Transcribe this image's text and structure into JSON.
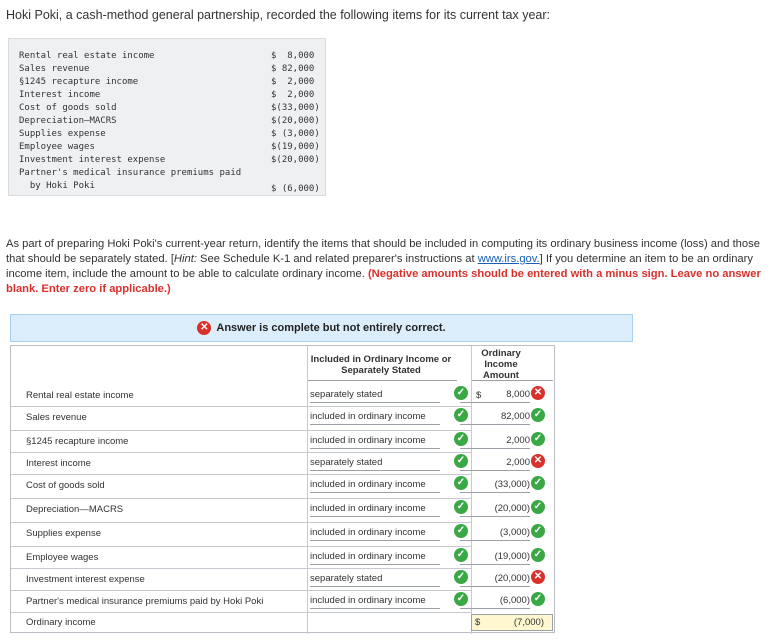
{
  "intro": "Hoki Poki, a cash-method general partnership, recorded the following items for its current tax year:",
  "items": [
    {
      "label": "Rental real estate income",
      "value": "$  8,000"
    },
    {
      "label": "Sales revenue",
      "value": "$ 82,000"
    },
    {
      "label": "§1245 recapture income",
      "value": "$  2,000"
    },
    {
      "label": "Interest income",
      "value": "$  2,000"
    },
    {
      "label": "Cost of goods sold",
      "value": "$(33,000)"
    },
    {
      "label": "Depreciation—MACRS",
      "value": "$(20,000)"
    },
    {
      "label": "Supplies expense",
      "value": "$ (3,000)"
    },
    {
      "label": "Employee wages",
      "value": "$(19,000)"
    },
    {
      "label": "Investment interest expense",
      "value": "$(20,000)"
    },
    {
      "label": "Partner's medical insurance premiums paid",
      "value": ""
    },
    {
      "label": "  by Hoki Poki",
      "value": "$ (6,000)"
    }
  ],
  "instructions": {
    "part1": "As part of preparing Hoki Poki's current-year return, identify the items that should be included in computing its ordinary business income (loss) and those that should be separately stated. [",
    "hint_label": "Hint:",
    "part2": " See Schedule K-1 and related preparer's instructions at ",
    "link": "www.irs.gov.",
    "part3": "] If you determine an item to be an ordinary income item, include the amount to be able to calculate ordinary income. ",
    "warning": "(Negative amounts should be entered with a minus sign. Leave no answer blank. Enter zero if applicable.)"
  },
  "banner": {
    "icon": "x-icon",
    "text": "Answer is complete but not entirely correct."
  },
  "table": {
    "col2_header": "Included in Ordinary Income or Separately Stated",
    "col3_header": "Ordinary Income Amount",
    "rows": [
      {
        "label": "Rental real estate income",
        "selection": "separately stated",
        "sel_ok": true,
        "dollar": "$",
        "amount": "8,000",
        "amt_ok": false
      },
      {
        "label": "Sales revenue",
        "selection": "included in ordinary income",
        "sel_ok": true,
        "dollar": "",
        "amount": "82,000",
        "amt_ok": true
      },
      {
        "label": "§1245 recapture income",
        "selection": "included in ordinary income",
        "sel_ok": true,
        "dollar": "",
        "amount": "2,000",
        "amt_ok": true
      },
      {
        "label": "Interest income",
        "selection": "separately stated",
        "sel_ok": true,
        "dollar": "",
        "amount": "2,000",
        "amt_ok": false
      },
      {
        "label": "Cost of goods sold",
        "selection": "included in ordinary income",
        "sel_ok": true,
        "dollar": "",
        "amount": "(33,000)",
        "amt_ok": true
      },
      {
        "label": "Depreciation—MACRS",
        "selection": "included in ordinary income",
        "sel_ok": true,
        "dollar": "",
        "amount": "(20,000)",
        "amt_ok": true
      },
      {
        "label": "Supplies expense",
        "selection": "included in ordinary income",
        "sel_ok": true,
        "dollar": "",
        "amount": "(3,000)",
        "amt_ok": true
      },
      {
        "label": "Employee wages",
        "selection": "included in ordinary income",
        "sel_ok": true,
        "dollar": "",
        "amount": "(19,000)",
        "amt_ok": true
      },
      {
        "label": "Investment interest expense",
        "selection": "separately stated",
        "sel_ok": true,
        "dollar": "",
        "amount": "(20,000)",
        "amt_ok": false
      },
      {
        "label": "Partner's medical insurance premiums paid by Hoki Poki",
        "selection": "included in ordinary income",
        "sel_ok": true,
        "dollar": "",
        "amount": "(6,000)",
        "amt_ok": true
      }
    ],
    "total": {
      "label": "Ordinary income",
      "dollar": "$",
      "amount": "(7,000)"
    }
  },
  "colors": {
    "correct": "#3aa845",
    "incorrect": "#d9302c",
    "banner_bg": "#dceefc",
    "total_bg": "#fff7cf"
  }
}
